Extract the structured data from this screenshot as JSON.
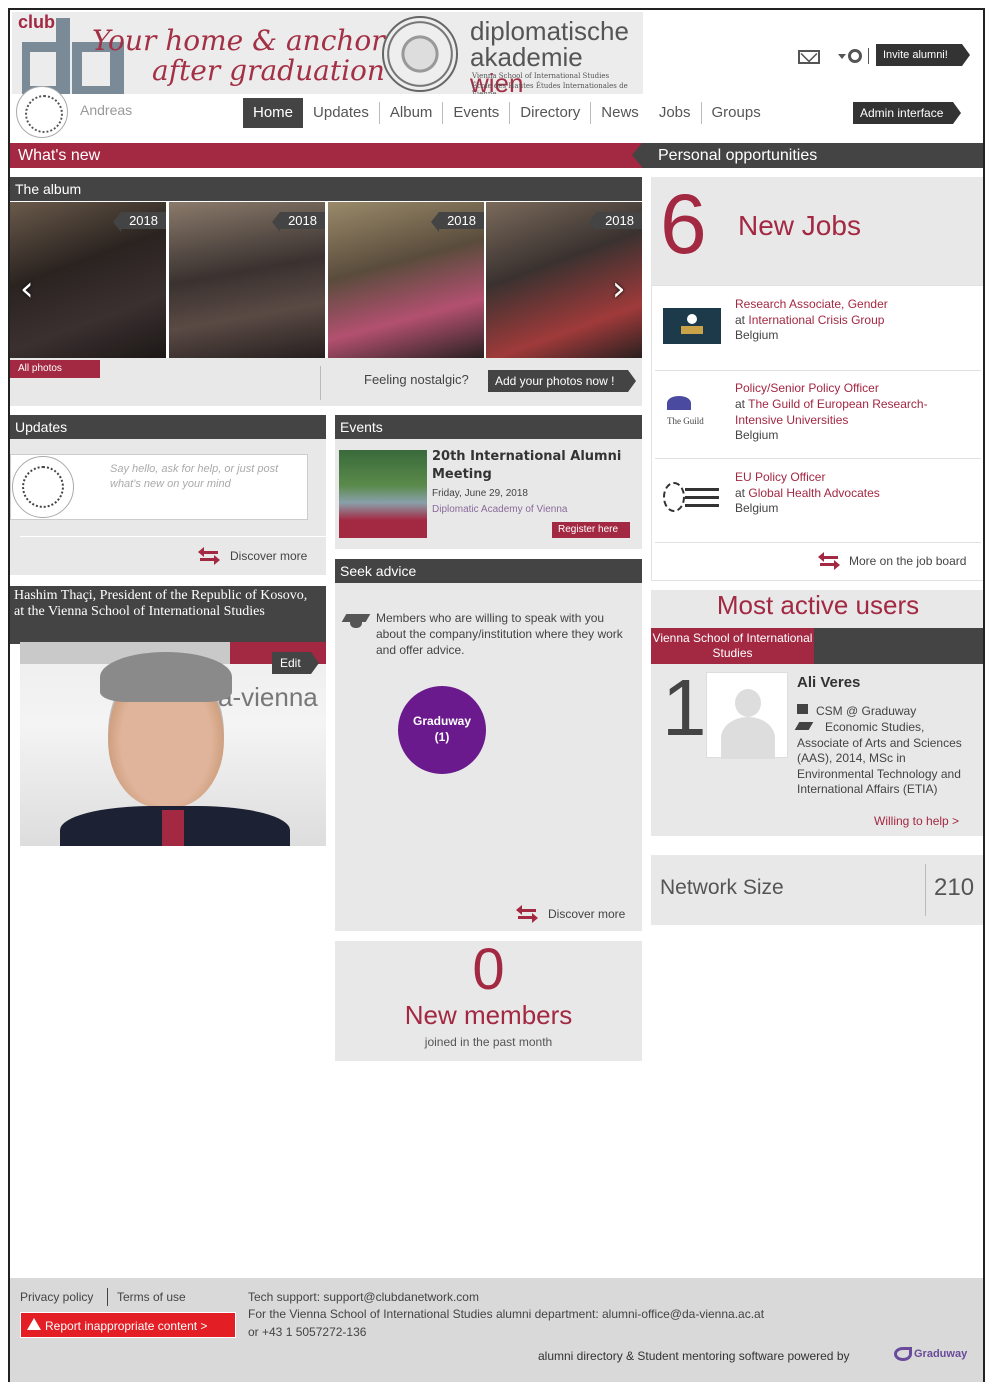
{
  "header": {
    "club_label": "club",
    "tagline_line1": "Your home & anchor",
    "tagline_line2": "after graduation",
    "school_line1": "diplomatische",
    "school_line2_a": "akademie",
    "school_line2_b": "wien",
    "school_sub1": "Vienna School of International Studies",
    "school_sub2": "École des Hautes Études Internationales de Vienne",
    "invite_label": "Invite alumni!",
    "username": "Andreas",
    "admin_label": "Admin interface"
  },
  "nav": {
    "items": [
      "Home",
      "Updates",
      "Album",
      "Events",
      "Directory",
      "News",
      "Jobs",
      "Groups"
    ],
    "active": "Home"
  },
  "bars": {
    "whats_new": "What's new",
    "personal_opportunities": "Personal opportunities"
  },
  "album": {
    "title": "The album",
    "years": [
      "2018",
      "2018",
      "2018",
      "2018"
    ],
    "all_photos": "All photos",
    "nostalgic": "Feeling nostalgic?",
    "add_photos": "Add your photos now !"
  },
  "updates": {
    "title": "Updates",
    "placeholder": "Say hello, ask for help, or just post what's new on your mind",
    "discover": "Discover more"
  },
  "events": {
    "title": "Events",
    "event_title": "20th International Alumni Meeting",
    "event_date": "Friday, June 29, 2018",
    "event_org": "Diplomatic Academy of Vienna",
    "register": "Register here"
  },
  "news_card": {
    "title": "Hashim Thaçi, President of the Republic of Kosovo, at the Vienna School of International Studies",
    "edit": "Edit",
    "photo_text": "a-vienna"
  },
  "seek": {
    "title": "Seek advice",
    "text": "Members who are willing to speak with you about the company/institution where they work and offer advice.",
    "bubble_name": "Graduway",
    "bubble_count": "(1)",
    "discover": "Discover more"
  },
  "new_members": {
    "count": "0",
    "label": "New members",
    "sub": "joined in the past month"
  },
  "jobs": {
    "count": "6",
    "label": "New Jobs",
    "list": [
      {
        "title": "Research Associate, Gender",
        "at": "at",
        "org": "International Crisis Group",
        "loc": "Belgium",
        "logo": "crisis-group-logo"
      },
      {
        "title": "Policy/Senior Policy Officer",
        "at": "at",
        "org": "The Guild of European Research-Intensive Universities",
        "loc": "Belgium",
        "logo": "the-guild-logo"
      },
      {
        "title": "EU Policy Officer",
        "at": "at",
        "org": "Global Health Advocates",
        "loc": "Belgium",
        "logo": "global-health-advocates-logo"
      }
    ],
    "more": "More on the job board"
  },
  "active_users": {
    "title": "Most active users",
    "group": "Vienna School of International Studies",
    "rank": "1",
    "name": "Ali Veres",
    "job": "CSM @ Graduway",
    "edu": "Economic Studies, Associate of Arts and Sciences (AAS), 2014, MSc in Environmental Technology and International Affairs (ETIA)",
    "help": "Willing to help >"
  },
  "network": {
    "label": "Network Size",
    "value": "210"
  },
  "footer": {
    "privacy": "Privacy policy",
    "terms": "Terms of use",
    "report": "Report inappropriate content >",
    "support": "Tech support: support@clubdanetwork.com",
    "dept": "For the Vienna School of International Studies alumni department: alumni-office@da-vienna.ac.at",
    "phone": "or +43 1 5057272-136",
    "powered": "alumni directory & Student mentoring software powered by",
    "brand": "Graduway"
  },
  "colors": {
    "accent": "#a32842",
    "dark": "#444444",
    "panel": "#e8e8e8",
    "bubble": "#6a1a8c"
  }
}
